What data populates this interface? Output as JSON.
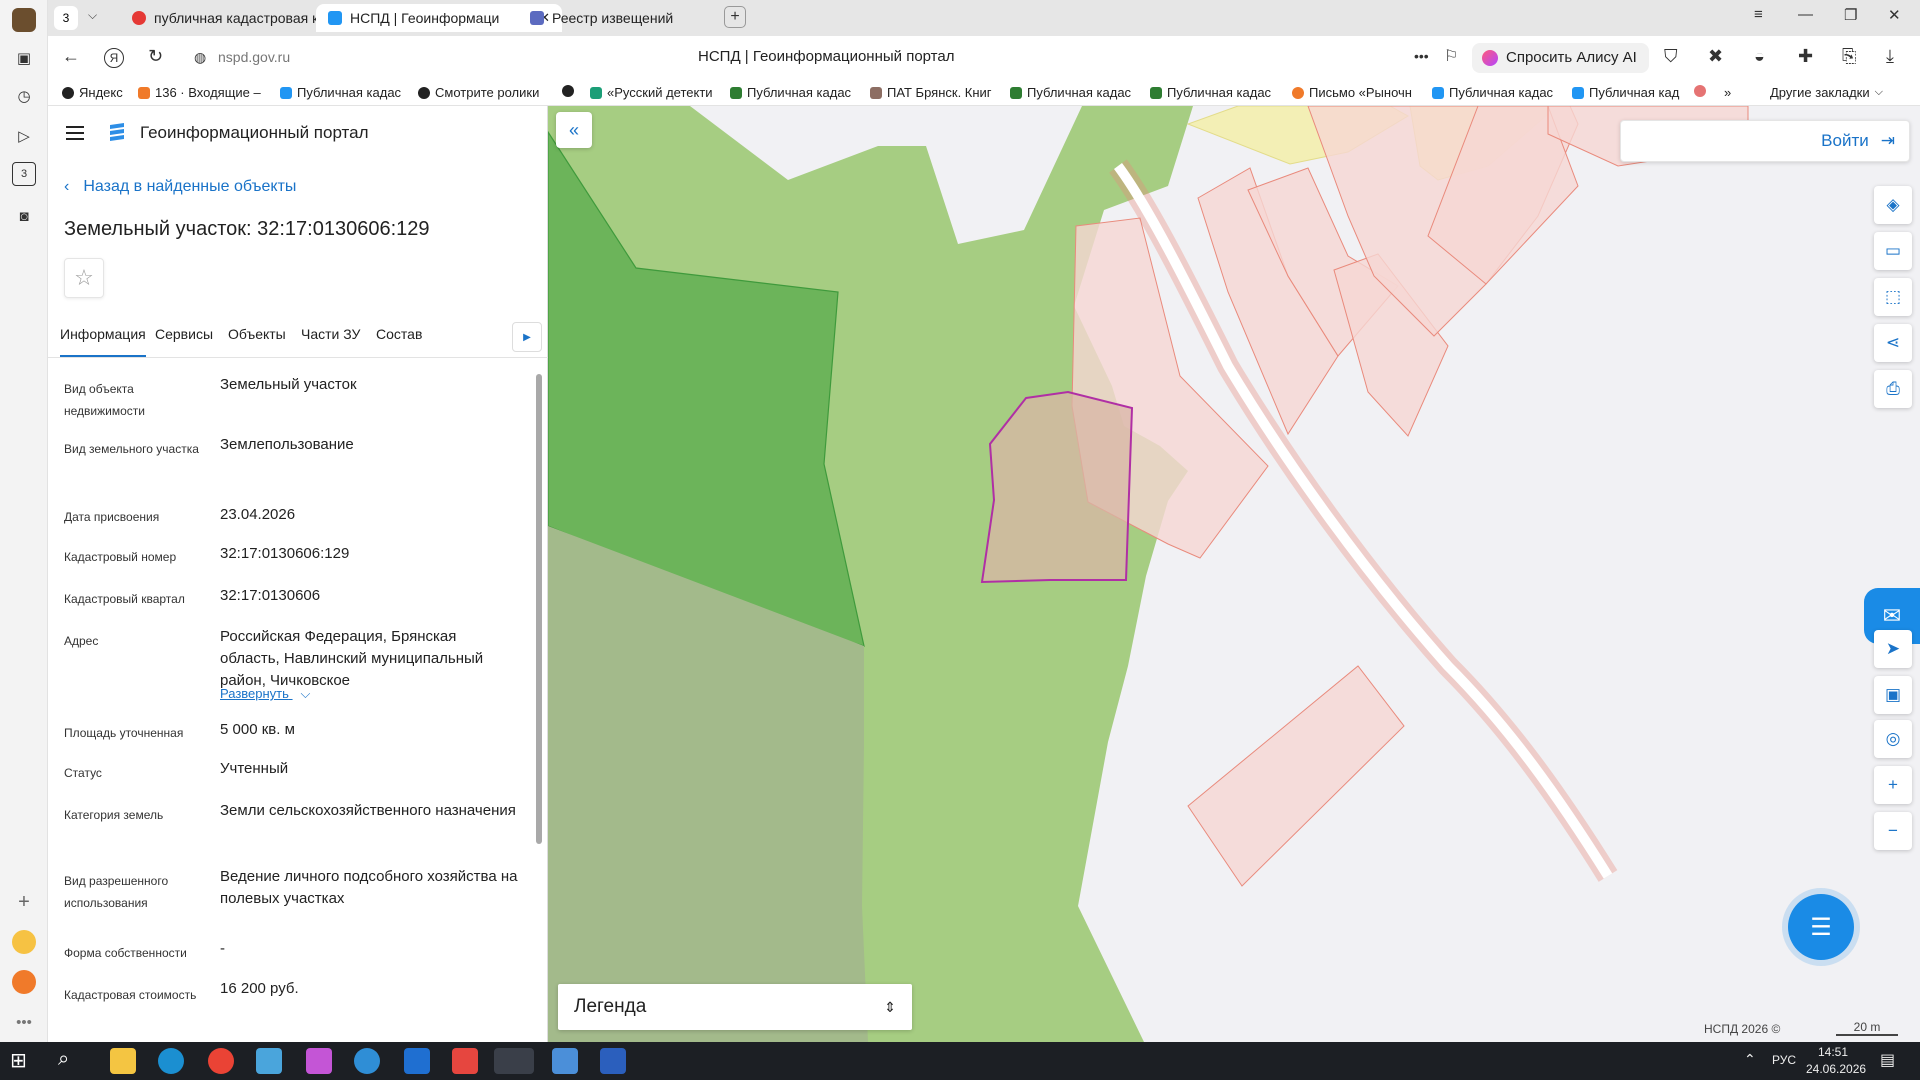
{
  "browser": {
    "tab_count_badge": "3",
    "tabs": [
      {
        "label": "публичная кадастровая к"
      },
      {
        "label": "НСПД | Геоинформаци"
      },
      {
        "label": "Реестр извещений"
      }
    ],
    "new_tab": "+",
    "url": "nspd.gov.ru",
    "page_title": "НСПД | Геоинформационный портал",
    "alice_label": "Спросить Алису AI",
    "bookmarks": [
      "Яндекс",
      "136 · Входящие –",
      "Публичная кадас",
      "Смотрите ролики",
      "",
      "«Русский детекти",
      "Публичная кадас",
      "ПАТ Брянск. Книг",
      "Публичная кадас",
      "Публичная кадас",
      "Письмо «Рыночн",
      "Публичная кадас",
      "Публичная кад"
    ],
    "bookmarks_more": "»",
    "other_bookmarks": "Другие закладки"
  },
  "panel": {
    "portal_name": "Геоинформационный портал",
    "back_label": "Назад в найденные объекты",
    "object_title": "Земельный участок: 32:17:0130606:129",
    "tabs": [
      "Информация",
      "Сервисы",
      "Объекты",
      "Части ЗУ",
      "Состав"
    ],
    "rows": [
      {
        "label": "Вид объекта недвижимости",
        "value": "Земельный участок"
      },
      {
        "label": "Вид земельного участка",
        "value": "Землепользование"
      },
      {
        "label": "Дата присвоения",
        "value": "23.04.2026"
      },
      {
        "label": "Кадастровый номер",
        "value": "32:17:0130606:129"
      },
      {
        "label": "Кадастровый квартал",
        "value": "32:17:0130606"
      },
      {
        "label": "Адрес",
        "value": "Российская Федерация, Брянская область, Навлинский муниципальный район, Чичковское"
      },
      {
        "label": "Площадь уточненная",
        "value": "5 000 кв. м"
      },
      {
        "label": "Статус",
        "value": "Учтенный"
      },
      {
        "label": "Категория земель",
        "value": "Земли сельскохозяйственного назначения"
      },
      {
        "label": "Вид разрешенного использования",
        "value": "Ведение личного подсобного хозяйства на полевых участках"
      },
      {
        "label": "Форма собственности",
        "value": "-"
      },
      {
        "label": "Кадастровая стоимость",
        "value": "16 200 руб."
      }
    ],
    "expand_label": "Развернуть"
  },
  "map": {
    "login_label": "Войти",
    "legend_label": "Легенда",
    "copyright": "НСПД 2026 ©",
    "scale_label": "20 m"
  },
  "taskbar": {
    "language": "РУС",
    "time": "14:51",
    "date": "24.06.2026"
  }
}
